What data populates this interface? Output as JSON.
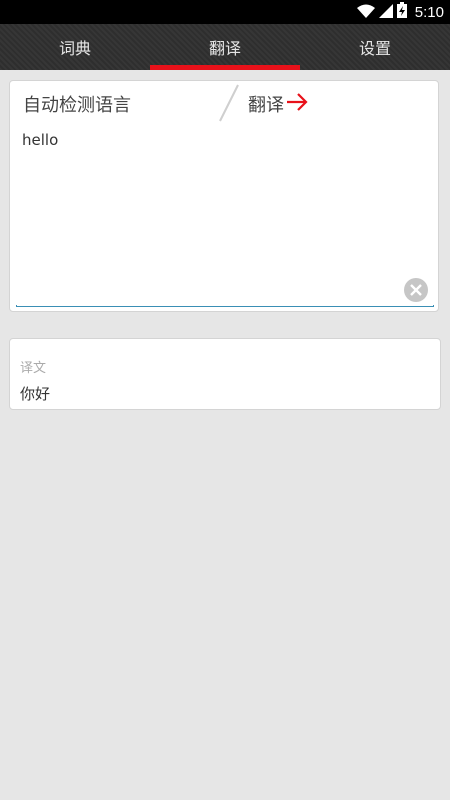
{
  "status_bar": {
    "time": "5:10",
    "icons": [
      "wifi-icon",
      "cellular-signal-icon",
      "battery-charging-icon"
    ]
  },
  "tabs": [
    {
      "label": "词典",
      "active": false
    },
    {
      "label": "翻译",
      "active": true
    },
    {
      "label": "设置",
      "active": false
    }
  ],
  "accent_color": "#e8111a",
  "translator": {
    "source_language": "自动检测语言",
    "translate_button": "翻译",
    "source_text": "hello",
    "icons": [
      "arrow-right-icon",
      "clear-icon"
    ]
  },
  "result": {
    "label": "译文",
    "text": "你好"
  }
}
